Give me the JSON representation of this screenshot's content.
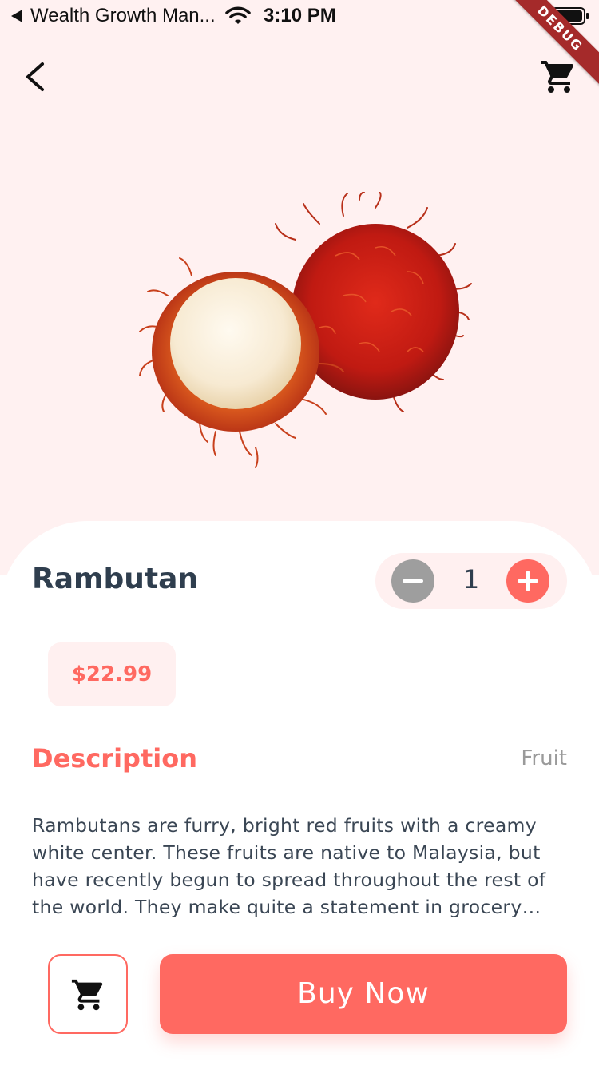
{
  "status_bar": {
    "app_name": "Wealth Growth Man...",
    "time": "3:10 PM",
    "debug_label": "DEBUG"
  },
  "nav": {
    "back_icon": "chevron-left-icon",
    "cart_icon": "shopping-cart-icon"
  },
  "product": {
    "name": "Rambutan",
    "price": "$22.99",
    "quantity": "1",
    "category": "Fruit",
    "description_title": "Description",
    "description": "Rambutans are furry, bright red fruits with a creamy white center. These fruits are native to Malaysia, but have recently begun to spread throughout the rest of the world. They make quite a statement in grocery stores."
  },
  "actions": {
    "buy_label": "Buy Now",
    "add_to_cart_icon": "shopping-cart-icon"
  },
  "colors": {
    "accent": "#ff6961",
    "background_top": "#fff1f1",
    "text_dark": "#2f3e4e",
    "muted": "#9e9e9e"
  }
}
